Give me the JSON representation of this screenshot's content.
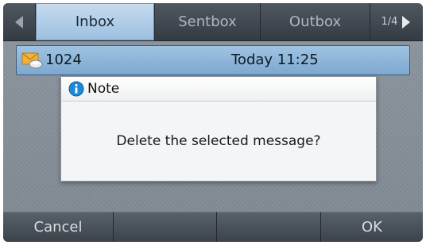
{
  "tabs": {
    "items": [
      {
        "label": "Inbox",
        "active": true
      },
      {
        "label": "Sentbox",
        "active": false
      },
      {
        "label": "Outbox",
        "active": false
      }
    ],
    "page_indicator": "1/4"
  },
  "message": {
    "number": "1024",
    "time": "Today 11:25",
    "icon": "envelope-icon"
  },
  "dialog": {
    "title": "Note",
    "icon": "info-icon",
    "message": "Delete the selected message?"
  },
  "softkeys": {
    "cancel_label": "Cancel",
    "key2_label": "",
    "key3_label": "",
    "ok_label": "OK"
  },
  "colors": {
    "active_tab": "#9cbfdf",
    "selected_row": "#8fb5da",
    "tabbar": "#3b424a",
    "info_icon": "#1e8ad6"
  }
}
